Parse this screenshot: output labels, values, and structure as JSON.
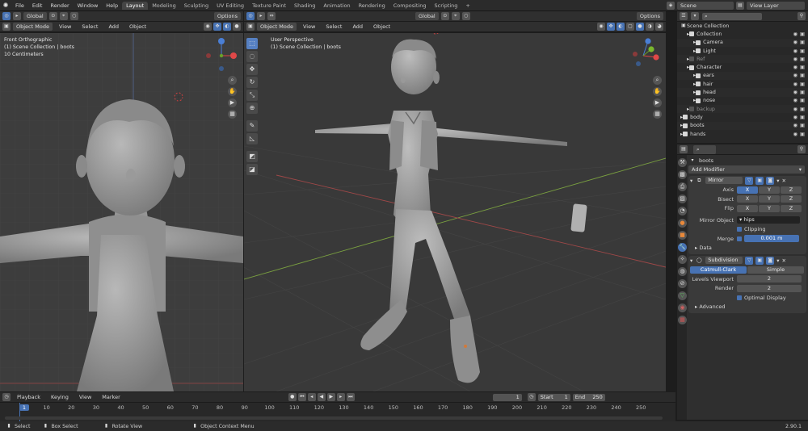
{
  "menus": [
    "File",
    "Edit",
    "Render",
    "Window",
    "Help"
  ],
  "workspaces": [
    "Layout",
    "Modeling",
    "Sculpting",
    "UV Editing",
    "Texture Paint",
    "Shading",
    "Animation",
    "Rendering",
    "Compositing",
    "Scripting"
  ],
  "scene": "Scene",
  "view_layer": "View Layer",
  "left_header": {
    "mode": "Object Mode",
    "menus": [
      "View",
      "Select",
      "Add",
      "Object"
    ]
  },
  "left_overlay": {
    "line1": "Front Orthographic",
    "line2": "(1) Scene Collection | boots",
    "line3": "10 Centimeters"
  },
  "mid_header": {
    "mode": "Object Mode",
    "menus": [
      "View",
      "Select",
      "Add",
      "Object"
    ],
    "orientation": "Global",
    "options": "Options"
  },
  "mid_overlay": {
    "line1": "User Perspective",
    "line2": "(1) Scene Collection | boots"
  },
  "left_extra": {
    "orientation": "Global",
    "options": "Options"
  },
  "outliner": {
    "root": "Scene Collection",
    "rows": [
      {
        "label": "Collection",
        "indent": 1,
        "checked": true
      },
      {
        "label": "Camera",
        "indent": 2
      },
      {
        "label": "Light",
        "indent": 2
      },
      {
        "label": "Ref",
        "indent": 1,
        "dim": true
      },
      {
        "label": "Character",
        "indent": 1,
        "checked": true
      },
      {
        "label": "ears",
        "indent": 2
      },
      {
        "label": "hair",
        "indent": 2
      },
      {
        "label": "head",
        "indent": 2
      },
      {
        "label": "nose",
        "indent": 2
      },
      {
        "label": "backup",
        "indent": 1,
        "dim": true
      },
      {
        "label": "body",
        "indent": 0
      },
      {
        "label": "boots",
        "indent": 0
      },
      {
        "label": "hands",
        "indent": 0
      }
    ]
  },
  "properties": {
    "object": "boots",
    "add_modifier": "Add Modifier",
    "mirror": {
      "name": "Mirror",
      "axis_label": "Axis",
      "bisect_label": "Bisect",
      "flip_label": "Flip",
      "x": "X",
      "y": "Y",
      "z": "Z",
      "mirror_object_label": "Mirror Object",
      "mirror_object": "hips",
      "clipping": "Clipping",
      "merge_label": "Merge",
      "merge_value": "0.001 m",
      "data": "Data"
    },
    "subdivision": {
      "name": "Subdivision",
      "catmull": "Catmull-Clark",
      "simple": "Simple",
      "levels_label": "Levels Viewport",
      "levels": "2",
      "render_label": "Render",
      "render": "2",
      "optimal": "Optimal Display",
      "advanced": "Advanced"
    }
  },
  "timeline": {
    "menus": [
      "Playback",
      "Keying",
      "View",
      "Marker"
    ],
    "current": "1",
    "start_label": "Start",
    "start": "1",
    "end_label": "End",
    "end": "250",
    "ticks": [
      "1",
      "10",
      "20",
      "30",
      "40",
      "50",
      "60",
      "70",
      "80",
      "90",
      "100",
      "110",
      "120",
      "130",
      "140",
      "150",
      "160",
      "170",
      "180",
      "190",
      "200",
      "210",
      "220",
      "230",
      "240",
      "250"
    ]
  },
  "status": {
    "select": "Select",
    "box_select": "Box Select",
    "rotate": "Rotate View",
    "context": "Object Context Menu",
    "version": "2.90.1"
  }
}
